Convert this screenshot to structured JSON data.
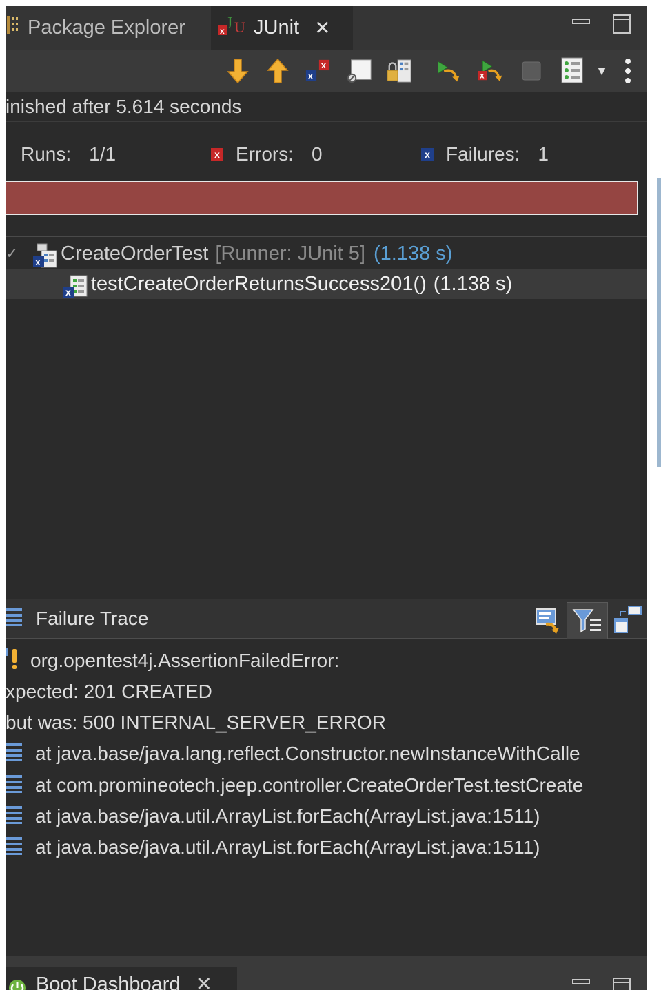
{
  "tabs": {
    "package_explorer": "Package Explorer",
    "junit": "JUnit",
    "junit_close": "✕",
    "minimize": "▭",
    "maximize": "☐"
  },
  "toolbar": {
    "icons": [
      "next-failure-icon",
      "previous-failure-icon",
      "show-failures-only-icon",
      "scroll-lock-icon",
      "history-icon",
      "rerun-icon",
      "rerun-failed-icon",
      "stop-icon",
      "test-run-history-icon",
      "view-menu-icon"
    ]
  },
  "status": {
    "text": "inished after 5.614 seconds"
  },
  "counters": {
    "runs_label": "Runs:",
    "runs_value": "1/1",
    "errors_label": "Errors:",
    "errors_value": "0",
    "failures_label": "Failures:",
    "failures_value": "1"
  },
  "progress": {
    "fraction": 1.0,
    "color": "#954542"
  },
  "tree": {
    "suite": {
      "expand": "✓",
      "name": "CreateOrderTest",
      "runner": "[Runner: JUnit 5]",
      "time": "(1.138 s)"
    },
    "test": {
      "name": "testCreateOrderReturnsSuccess201()",
      "time": "(1.138 s)"
    }
  },
  "failure_trace": {
    "title": "Failure Trace",
    "lines": [
      {
        "icon": "warning",
        "text": "org.opentest4j.AssertionFailedError:"
      },
      {
        "icon": "none",
        "text": "xpected: 201 CREATED"
      },
      {
        "icon": "none",
        "text": "but was: 500 INTERNAL_SERVER_ERROR"
      },
      {
        "icon": "stack",
        "text": "at java.base/java.lang.reflect.Constructor.newInstanceWithCalle"
      },
      {
        "icon": "stack",
        "text": "at com.promineotech.jeep.controller.CreateOrderTest.testCreate"
      },
      {
        "icon": "stack",
        "text": "at java.base/java.util.ArrayList.forEach(ArrayList.java:1511)"
      },
      {
        "icon": "stack",
        "text": "at java.base/java.util.ArrayList.forEach(ArrayList.java:1511)"
      }
    ]
  },
  "bottom_tab": {
    "label": "Boot Dashboard",
    "close": "✕"
  }
}
